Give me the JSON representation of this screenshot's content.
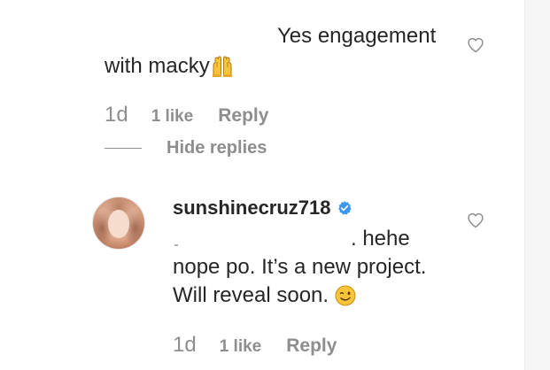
{
  "comment": {
    "text_line1": "Yes engagement",
    "text_line2": "with macky",
    "time": "1d",
    "likes": "1 like",
    "reply_label": "Reply",
    "hide_replies_label": "Hide replies",
    "emoji": "raising-hands-emoji"
  },
  "reply": {
    "username": "sunshinecruz718",
    "verified": "verified-badge-icon",
    "text_line1": ". hehe",
    "text_line2": "nope po. It’s a new project.",
    "text_line3": "Will reveal soon.",
    "emoji": "winking-face-emoji",
    "time": "1d",
    "likes": "1 like",
    "reply_label": "Reply"
  },
  "colors": {
    "primary_text": "#262626",
    "secondary_text": "#8e8e8e",
    "verified_blue": "#3897f0",
    "emoji_yellow": "#f8c43a"
  },
  "icons": {
    "like": "heart-outline-icon"
  }
}
